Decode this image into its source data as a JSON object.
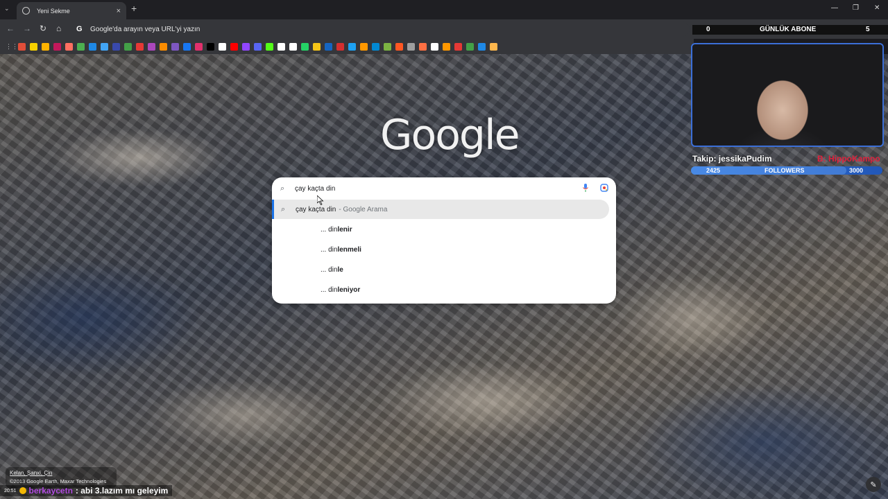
{
  "browser": {
    "tab_title": "Yeni Sekme",
    "tab_close": "×",
    "new_tab": "+",
    "tab_search": "⌄",
    "window_controls": {
      "minimize": "—",
      "restore": "❐",
      "close": "✕"
    },
    "nav": {
      "back": "←",
      "forward": "→",
      "reload": "↻",
      "home": "⌂"
    },
    "omnibox_placeholder": "Google'da arayın veya URL'yi yazın",
    "omnibox_icon": "G",
    "apps_icon": "⋮⋮",
    "bookmark_colors": [
      "#e04e39",
      "#f7d000",
      "#ffb300",
      "#c2185b",
      "#ff6f61",
      "#4caf50",
      "#1e88e5",
      "#42a5f5",
      "#3949ab",
      "#43a047",
      "#e53935",
      "#ab47bc",
      "#fb8c00",
      "#7e57c2",
      "#1877f2",
      "#e1306c",
      "#000000",
      "#ffffff",
      "#ff0000",
      "#9146ff",
      "#5865f2",
      "#53fc18",
      "#ffffff",
      "#ffffff",
      "#25d366",
      "#f5c518",
      "#1565c0",
      "#d32f2f",
      "#1da1f2",
      "#ff9800",
      "#0288d1",
      "#7cb342",
      "#ff5722",
      "#9e9e9e",
      "#ff7043",
      "#ffffff",
      "#ff9800",
      "#e53935",
      "#43a047",
      "#1e88e5",
      "#ffb74d"
    ]
  },
  "google": {
    "logo": "Google",
    "query": "çay kaçta din",
    "search_icon": "search-icon",
    "top_suggestion": {
      "text": "çay kaçta din",
      "hint": "- Google Arama"
    },
    "suggestions": [
      {
        "prefix": "... din",
        "bold": "lenir"
      },
      {
        "prefix": "... din",
        "bold": "lenmeli"
      },
      {
        "prefix": "... din",
        "bold": "le"
      },
      {
        "prefix": "... din",
        "bold": "leniyor"
      }
    ]
  },
  "overlay": {
    "subs_count": "0",
    "subs_label": "GÜNLÜK ABONE",
    "viewer_count": "5",
    "follow_text": "Takip: jessikaPudim",
    "sub_text": "B: HippoKampo",
    "follow_current": "2425",
    "follow_label": "FOLLOWERS",
    "follow_goal": "3000",
    "follow_progress": 0.81
  },
  "footer": {
    "location": "Kelan, Şanxi, Çin",
    "copyright": "©2013 Google Earth, Maxar Technologies",
    "time": "20:51",
    "chat_user": "berkaycetn",
    "chat_msg": ": abi 3.lazım mı geleyim",
    "edit_icon": "✎"
  }
}
